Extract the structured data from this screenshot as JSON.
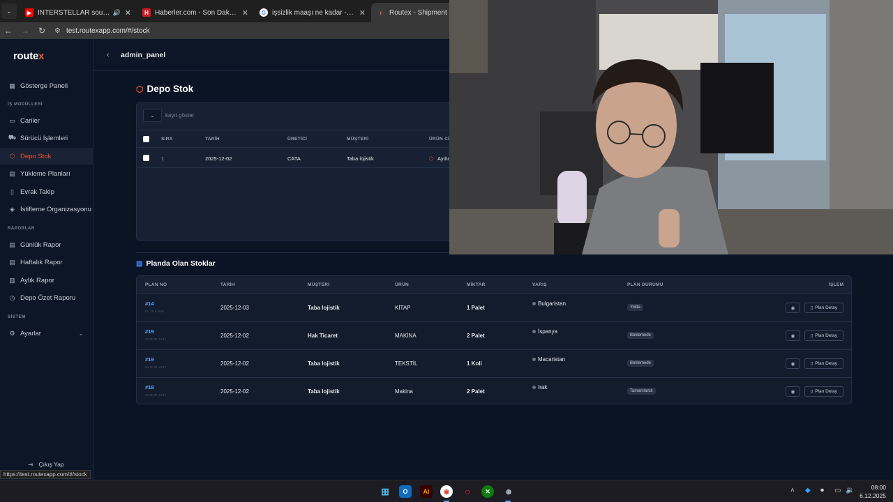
{
  "browser": {
    "tabs": [
      {
        "title": "INTERSTELLAR soundtrack",
        "favicon": "youtube-icon",
        "color": "#ff0000",
        "audio": true,
        "active": false
      },
      {
        "title": "Haberler.com - Son Dakika Hab",
        "favicon": "haberler-icon",
        "color": "#d71920",
        "active": false
      },
      {
        "title": "işsizlik maaşı ne kadar - Google",
        "favicon": "google-icon",
        "color": "#ffffff",
        "active": false
      },
      {
        "title": "Routex - Shipment Tracking Sys",
        "favicon": "routex-icon",
        "color": "#e8552a",
        "active": true
      }
    ],
    "url": "test.routexapp.com/#/stock",
    "status_url": "https://test.routexapp.com/#/stock"
  },
  "app": {
    "logo": "route",
    "logo_mark": "x",
    "panel_title": "admin_panel",
    "sidebar": {
      "dashboard": "Gösterge Paneli",
      "section_business": "İŞ MODÜLLERİ",
      "business_items": [
        "Cariler",
        "Sürücü İşlemleri",
        "Depo Stok",
        "Yükleme Planları",
        "Evrak Takip",
        "İstifleme Organizasyonu"
      ],
      "section_reports": "RAPORLAR",
      "report_items": [
        "Günlük Rapor",
        "Haftalık Rapor",
        "Aylık Rapor",
        "Depo Özet Raporu"
      ],
      "section_system": "SİSTEM",
      "system_items": [
        "Ayarlar"
      ],
      "logout": "Çıkış Yap",
      "active_item": "Depo Stok"
    },
    "stock": {
      "title": "Depo Stok",
      "show_label": "kayıt göster",
      "columns": [
        "SIRA",
        "TARİH",
        "ÜRETİCİ",
        "MÜŞTERİ",
        "ÜRÜN CİN"
      ],
      "rows": [
        {
          "sira": "1",
          "tarih": "2025-12-02",
          "uretici": "CATA",
          "musteri": "Taba lojistik",
          "urun": "Aydın"
        }
      ]
    },
    "plans": {
      "title": "Planda Olan Stoklar",
      "columns": [
        "PLAN NO",
        "TARİH",
        "MÜŞTERİ",
        "ÜRÜN",
        "MİKTAR",
        "VARIŞ",
        "PLAN DURUMU",
        "İŞLEM"
      ],
      "detail_label": "Plan Detay",
      "rows": [
        {
          "plan_no": "#14",
          "sub": "51 TRK 948",
          "tarih": "2025-12-03",
          "musteri": "Taba lojistik",
          "urun": "KİTAP",
          "miktar": "1 Palet",
          "varis": "Bulgaristan",
          "durum": "Yolda"
        },
        {
          "plan_no": "#19",
          "sub": "34 BHR 3434",
          "tarih": "2025-12-02",
          "musteri": "Hak Ticaret",
          "urun": "MAKİNA",
          "miktar": "2 Palet",
          "varis": "İspanya",
          "durum": "Beklemede"
        },
        {
          "plan_no": "#19",
          "sub": "34 BHR 3434",
          "tarih": "2025-12-02",
          "musteri": "Taba lojistik",
          "urun": "TEKSTİL",
          "miktar": "1 Koli",
          "varis": "Macaristan",
          "durum": "Beklemede"
        },
        {
          "plan_no": "#18",
          "sub": "34 BHR 3434",
          "tarih": "2025-12-02",
          "musteri": "Taba lojistik",
          "urun": "Makina",
          "miktar": "2 Palet",
          "varis": "Irak",
          "durum": "Tamamlandı"
        }
      ]
    }
  },
  "taskbar": {
    "time": "08:00",
    "date": "6.12.2025",
    "apps": [
      "start-icon",
      "outlook-icon",
      "illustrator-icon",
      "chrome-icon",
      "opera-icon",
      "xbox-icon",
      "steam-icon"
    ]
  }
}
